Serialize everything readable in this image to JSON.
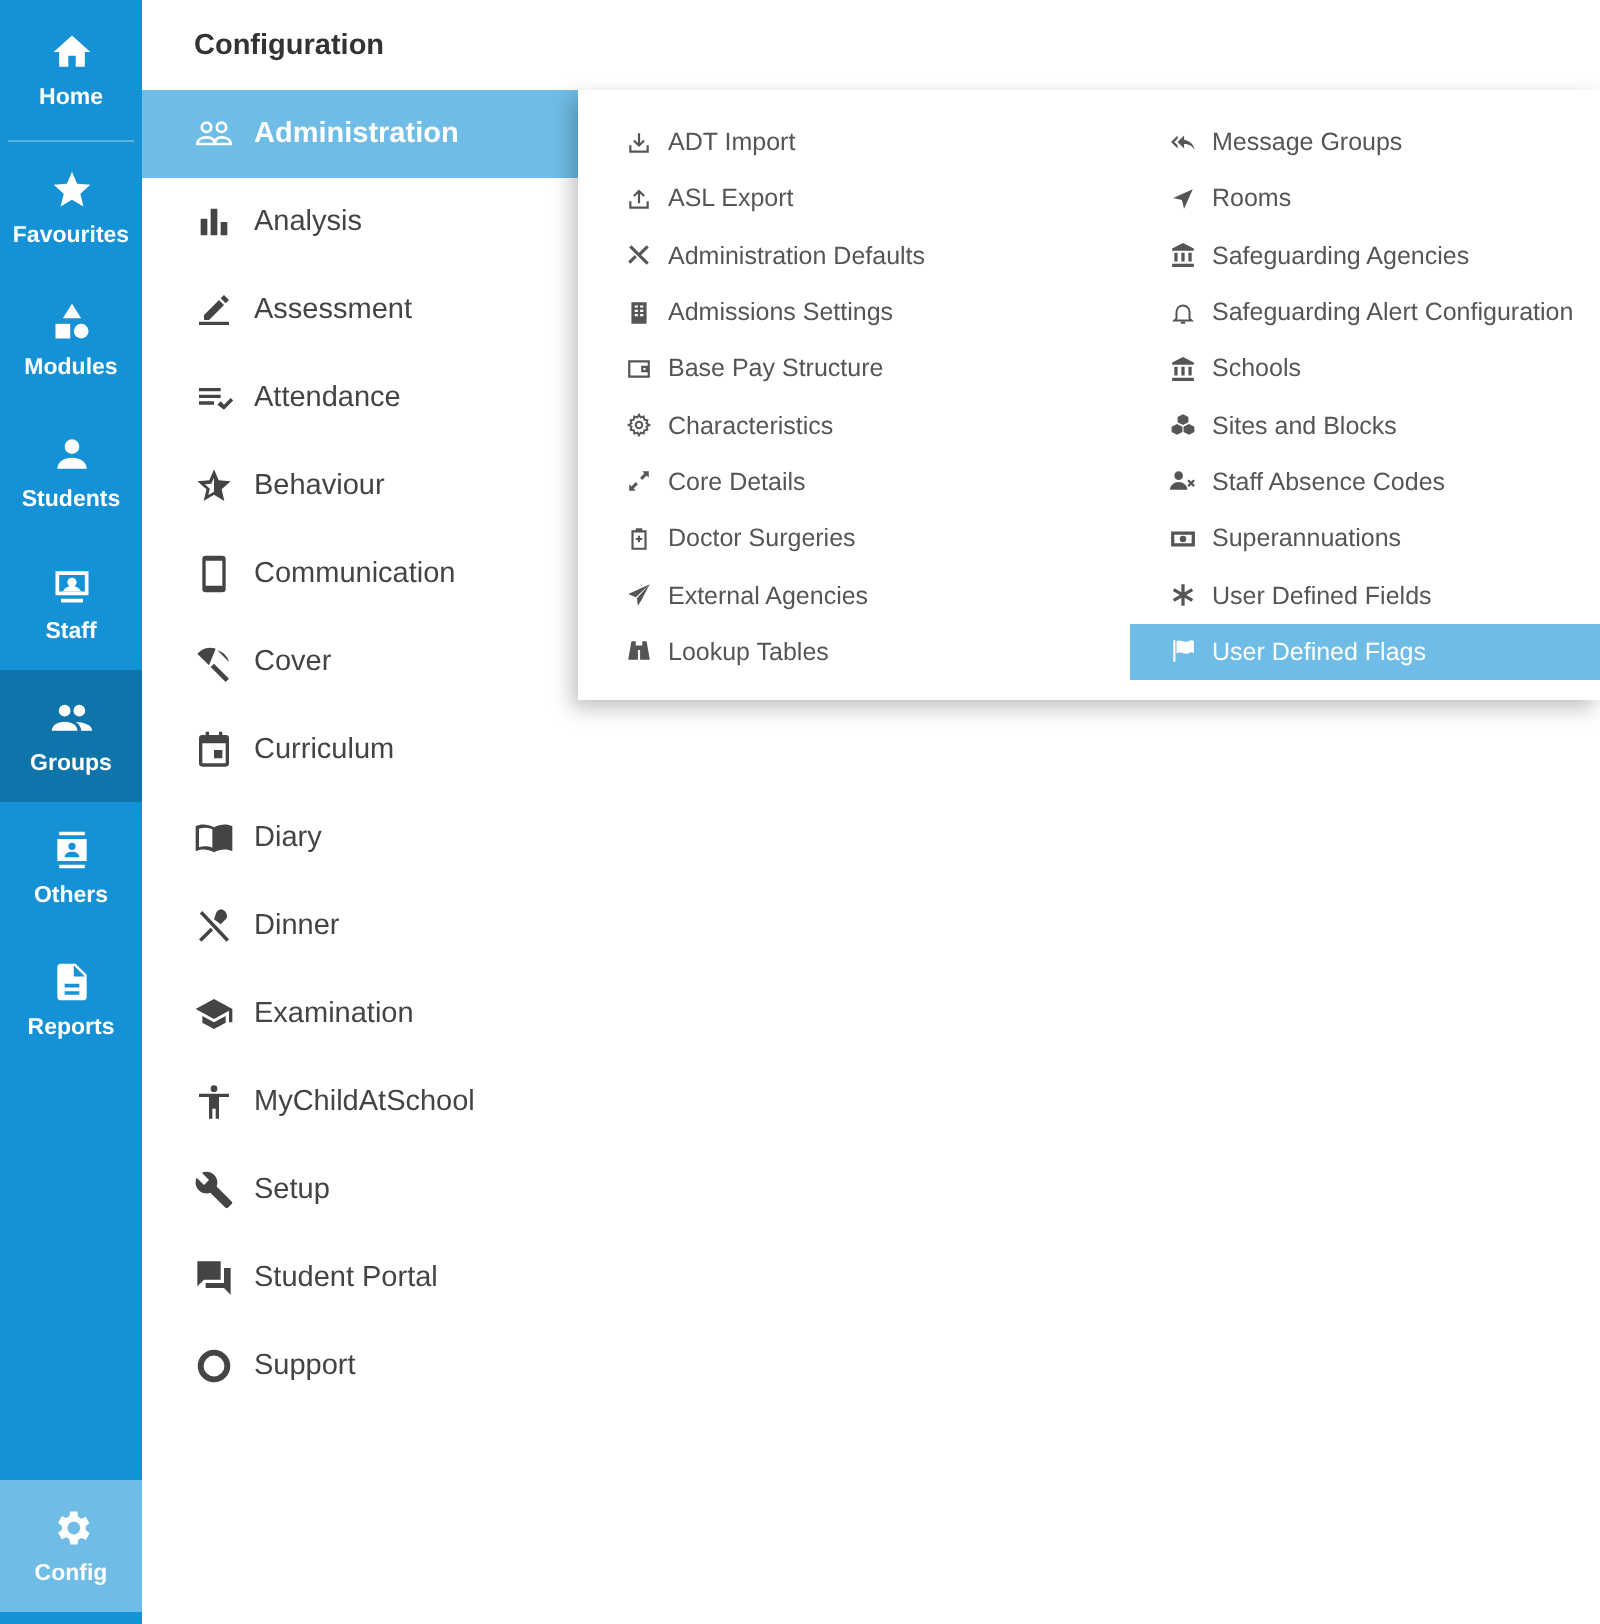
{
  "rail": {
    "items": [
      {
        "label": "Home",
        "selected": false
      },
      {
        "label": "Favourites",
        "selected": false
      },
      {
        "label": "Modules",
        "selected": false
      },
      {
        "label": "Students",
        "selected": false
      },
      {
        "label": "Staff",
        "selected": false
      },
      {
        "label": "Groups",
        "selected": true
      },
      {
        "label": "Others",
        "selected": false
      },
      {
        "label": "Reports",
        "selected": false
      }
    ],
    "footer": {
      "label": "Config",
      "selected": true
    }
  },
  "menu": {
    "title": "Configuration",
    "items": [
      {
        "label": "Administration",
        "selected": true
      },
      {
        "label": "Analysis",
        "selected": false
      },
      {
        "label": "Assessment",
        "selected": false
      },
      {
        "label": "Attendance",
        "selected": false
      },
      {
        "label": "Behaviour",
        "selected": false
      },
      {
        "label": "Communication",
        "selected": false
      },
      {
        "label": "Cover",
        "selected": false
      },
      {
        "label": "Curriculum",
        "selected": false
      },
      {
        "label": "Diary",
        "selected": false
      },
      {
        "label": "Dinner",
        "selected": false
      },
      {
        "label": "Examination",
        "selected": false
      },
      {
        "label": "MyChildAtSchool",
        "selected": false
      },
      {
        "label": "Setup",
        "selected": false
      },
      {
        "label": "Student Portal",
        "selected": false
      },
      {
        "label": "Support",
        "selected": false
      }
    ]
  },
  "submenu": {
    "columns": [
      [
        {
          "label": "ADT Import",
          "selected": false
        },
        {
          "label": "ASL Export",
          "selected": false
        },
        {
          "label": "Administration Defaults",
          "selected": false
        },
        {
          "label": "Admissions Settings",
          "selected": false
        },
        {
          "label": "Base Pay Structure",
          "selected": false
        },
        {
          "label": "Characteristics",
          "selected": false
        },
        {
          "label": "Core Details",
          "selected": false
        },
        {
          "label": "Doctor Surgeries",
          "selected": false
        },
        {
          "label": "External Agencies",
          "selected": false
        },
        {
          "label": "Lookup Tables",
          "selected": false
        }
      ],
      [
        {
          "label": "Message Groups",
          "selected": false
        },
        {
          "label": "Rooms",
          "selected": false
        },
        {
          "label": "Safeguarding Agencies",
          "selected": false
        },
        {
          "label": "Safeguarding Alert Configuration",
          "selected": false
        },
        {
          "label": "Schools",
          "selected": false
        },
        {
          "label": "Sites and Blocks",
          "selected": false
        },
        {
          "label": "Staff Absence Codes",
          "selected": false
        },
        {
          "label": "Superannuations",
          "selected": false
        },
        {
          "label": "User Defined Fields",
          "selected": false
        },
        {
          "label": "User Defined Flags",
          "selected": true
        }
      ]
    ]
  }
}
